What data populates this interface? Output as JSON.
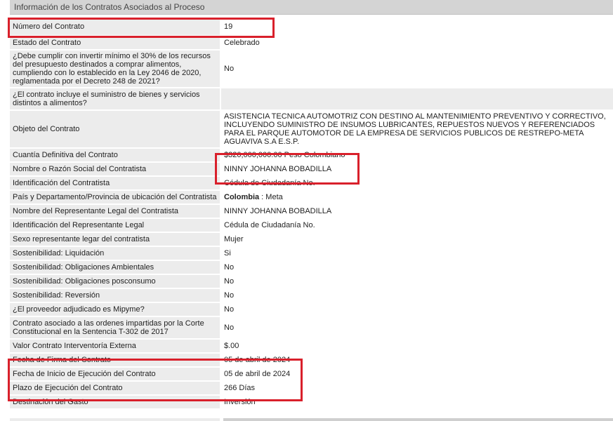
{
  "section_title": "Información de los Contratos Asociados al Proceso",
  "rows": [
    {
      "label": "Número del Contrato",
      "value": "19"
    },
    {
      "label": "Estado del Contrato",
      "value": "Celebrado"
    },
    {
      "label": "¿Debe cumplir con invertir mínimo el 30% de los recursos del presupuesto destinados a comprar alimentos, cumpliendo con lo establecido en la Ley 2046 de 2020, reglamentada por el Decreto 248 de 2021?",
      "value": "No"
    },
    {
      "label": "¿El contrato incluye el suministro de bienes y servicios distintos a alimentos?",
      "value": ""
    },
    {
      "label": "Objeto del Contrato",
      "value": "ASISTENCIA TECNICA AUTOMOTRIZ CON DESTINO AL MANTENIMIENTO PREVENTIVO Y CORRECTIVO, INCLUYENDO SUMINISTRO DE INSUMOS LUBRICANTES, REPUESTOS NUEVOS Y REFERENCIADOS PARA EL PARQUE AUTOMOTOR DE LA EMPRESA DE SERVICIOS PUBLICOS DE RESTREPO-META AGUAVIVA S.A E.S.P."
    },
    {
      "label": "Cuantía Definitiva del Contrato",
      "value": "$320,000,000.00 Peso Colombiano"
    },
    {
      "label": "Nombre o Razón Social del Contratista",
      "value": "NINNY JOHANNA BOBADILLA"
    },
    {
      "label": "Identificación del Contratista",
      "value": "Cédula de Ciudadanía No."
    },
    {
      "label": "País y Departamento/Provincia de ubicación del Contratista",
      "value_bold": "Colombia",
      "value": " : Meta"
    },
    {
      "label": "Nombre del Representante Legal del Contratista",
      "value": "NINNY JOHANNA BOBADILLA"
    },
    {
      "label": "Identificación del Representante Legal",
      "value": "Cédula de Ciudadanía No."
    },
    {
      "label": "Sexo representante legar del contratista",
      "value": "Mujer"
    },
    {
      "label": "Sostenibilidad: Liquidación",
      "value": "Si"
    },
    {
      "label": "Sostenibilidad: Obligaciones Ambientales",
      "value": "No"
    },
    {
      "label": "Sostenibilidad: Obligaciones posconsumo",
      "value": "No"
    },
    {
      "label": "Sostenibilidad: Reversión",
      "value": "No"
    },
    {
      "label": "¿El proveedor adjudicado es Mipyme?",
      "value": "No"
    },
    {
      "label": "Contrato asociado a las ordenes impartidas por la Corte Constitucional en la Sentencia T-302 de 2017",
      "value": "No"
    },
    {
      "label": "Valor Contrato Interventoría Externa",
      "value": "$.00"
    },
    {
      "label": "Fecha de Firma del Contrato",
      "value": "05 de abril de 2024"
    },
    {
      "label": "Fecha de Inicio de Ejecución del Contrato",
      "value": "05 de abril de 2024"
    },
    {
      "label": "Plazo de Ejecución del Contrato",
      "value": "266 Días"
    },
    {
      "label": "Destinación del Gasto",
      "value": "Inversión"
    }
  ],
  "colors": {
    "highlight": "#d9202b",
    "label_bg": "#ececec",
    "header_bg": "#d4d4d4"
  }
}
